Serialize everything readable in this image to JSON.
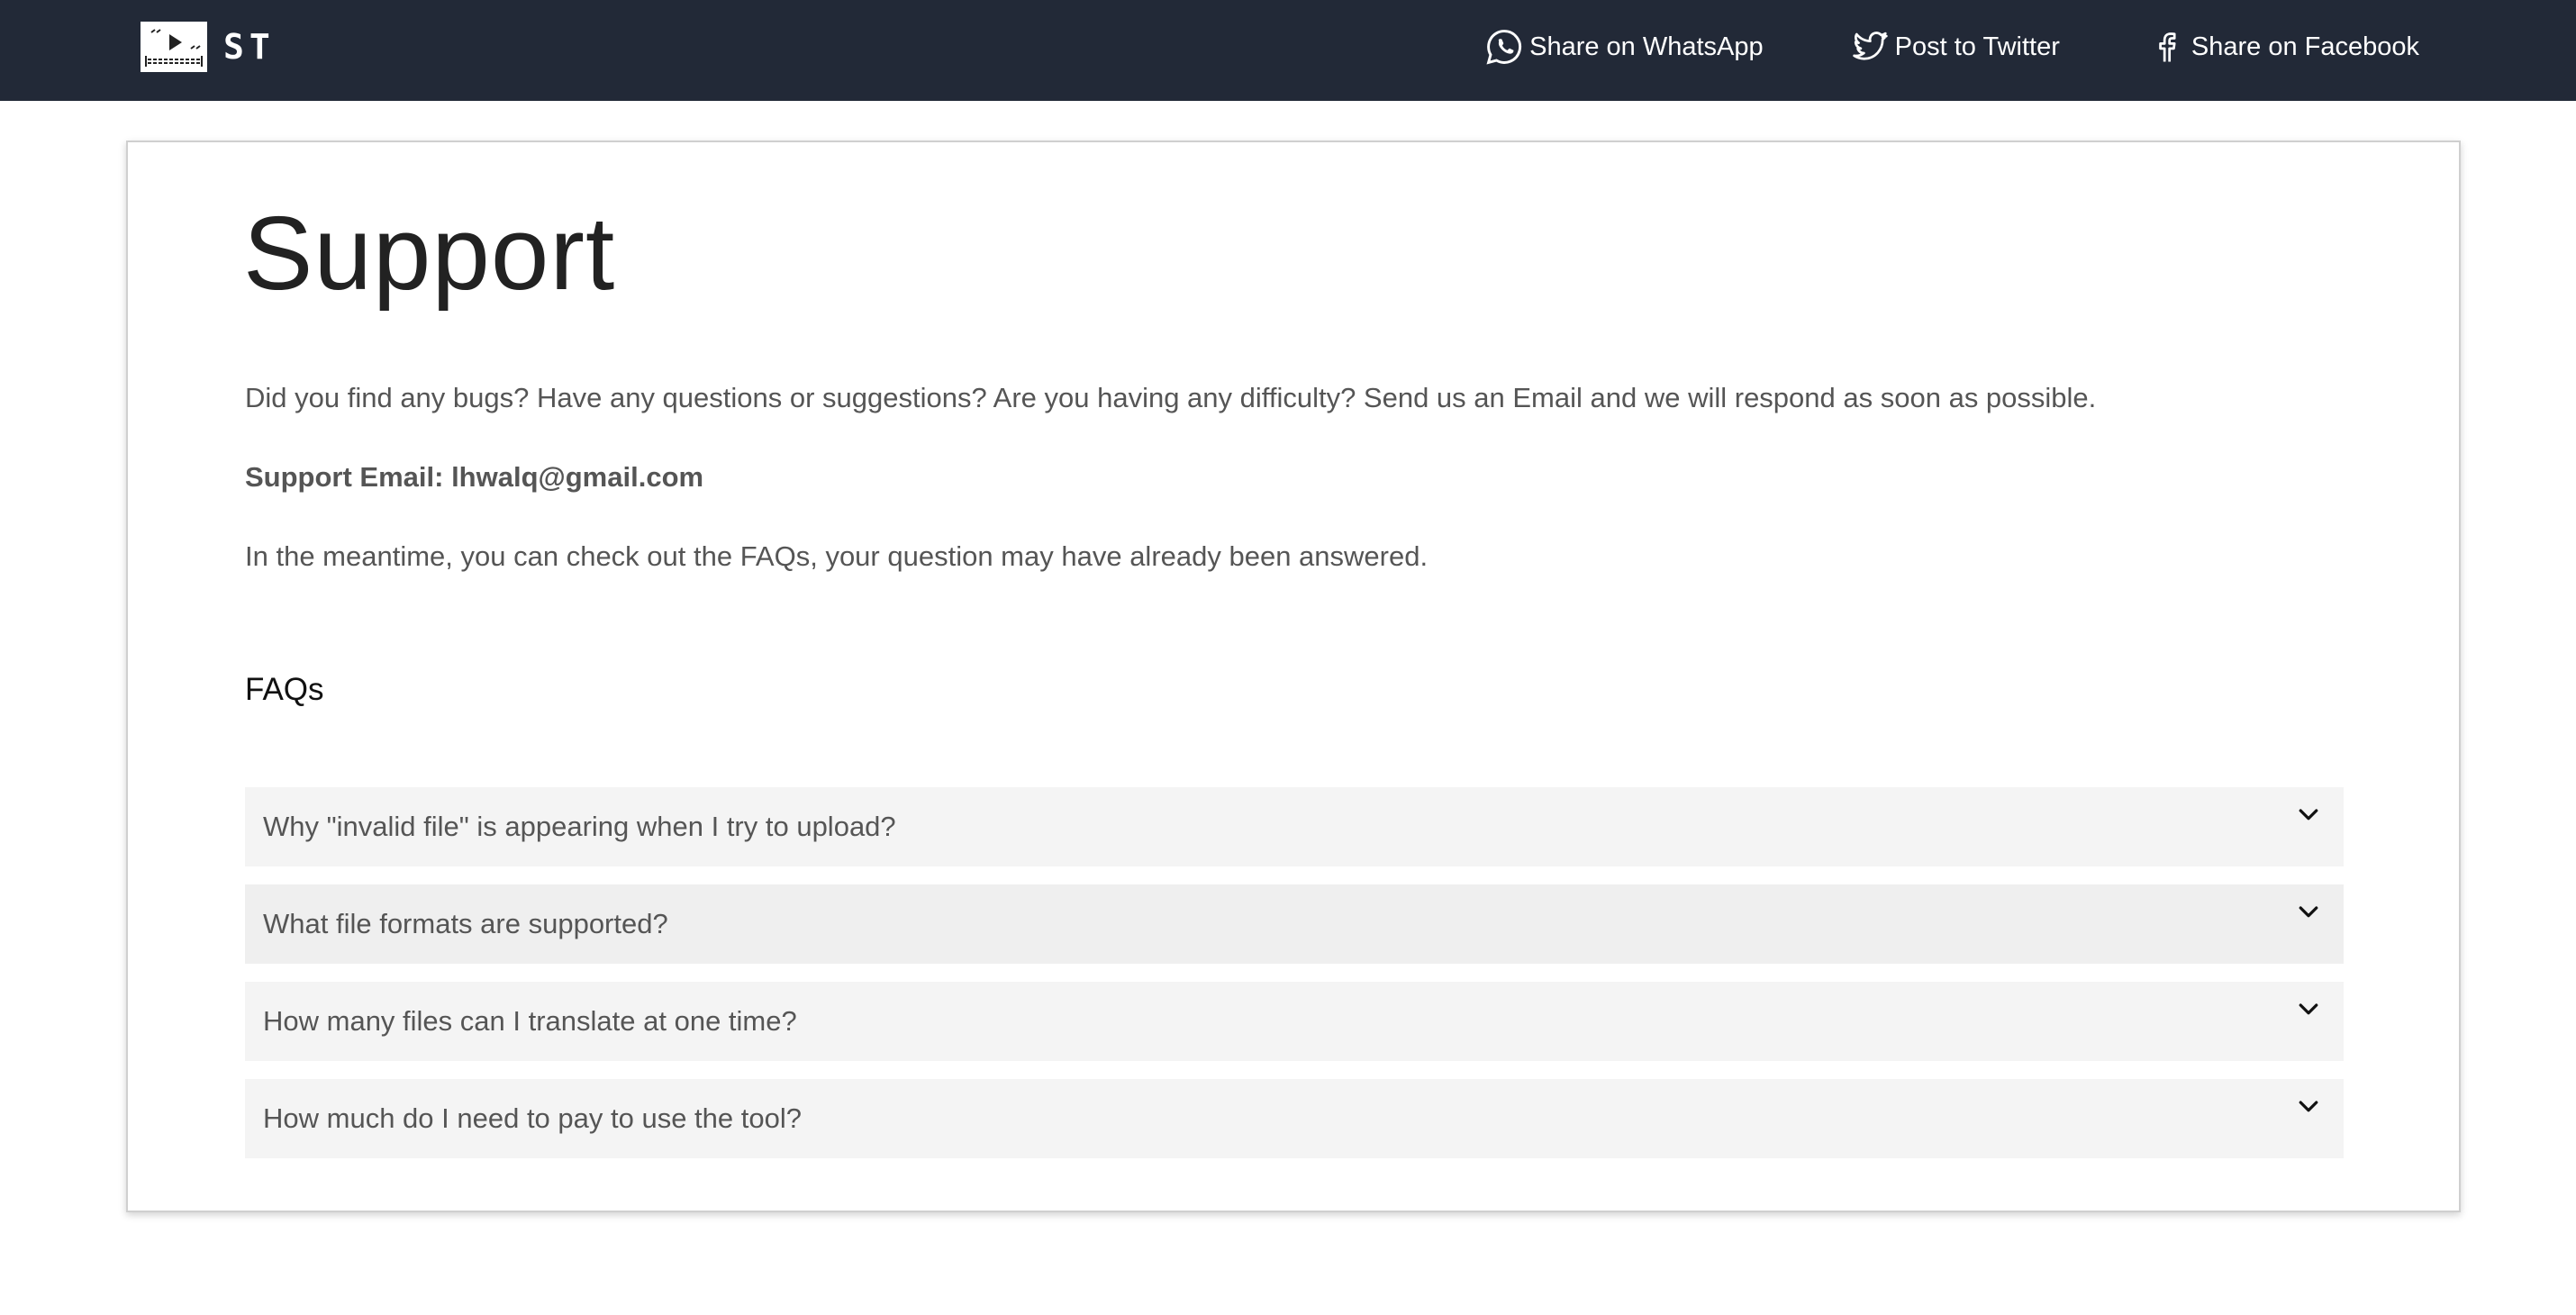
{
  "header": {
    "brand_text": "ST",
    "share_whatsapp": "Share on WhatsApp",
    "share_twitter": "Post to Twitter",
    "share_facebook": "Share on Facebook",
    "icons": [
      "whatsapp-icon",
      "twitter-icon",
      "facebook-icon"
    ],
    "background_color": "#222937"
  },
  "main": {
    "title": "Support",
    "intro": "Did you find any bugs? Have any questions or suggestions? Are you having any difficulty? Send us an Email and we will respond as soon as possible.",
    "support_email": "Support Email: lhwalq@gmail.com",
    "faq_note": "In the meantime, you can check out the FAQs, your question may have already been answered.",
    "faq_heading": "FAQs",
    "faqs": [
      {
        "question": "Why \"invalid file\" is appearing when I try to upload?"
      },
      {
        "question": "What file formats are supported?"
      },
      {
        "question": "How many files can I translate at one time?"
      },
      {
        "question": "How much do I need to pay to use the tool?"
      }
    ]
  }
}
